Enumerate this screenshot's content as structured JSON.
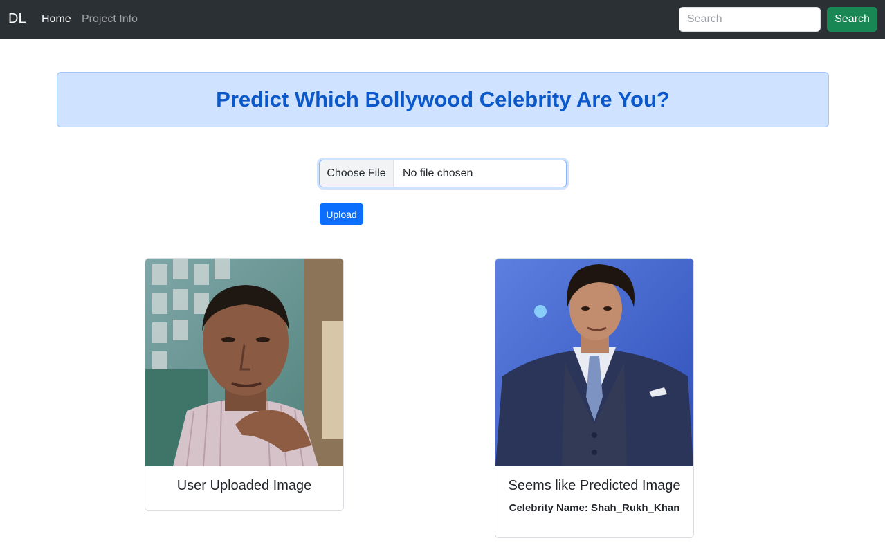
{
  "navbar": {
    "brand": "DL",
    "links": [
      {
        "label": "Home"
      },
      {
        "label": "Project Info"
      }
    ],
    "search": {
      "placeholder": "Search",
      "value": "",
      "button_label": "Search"
    }
  },
  "banner": {
    "title": "Predict Which Bollywood Celebrity Are You?"
  },
  "upload": {
    "choose_label": "Choose File",
    "file_status": "No file chosen",
    "button_label": "Upload"
  },
  "cards": {
    "user": {
      "title": "User Uploaded Image",
      "image": "user-photo"
    },
    "predicted": {
      "title": "Seems like Predicted Image",
      "caption": "Celebrity Name: Shah_Rukh_Khan",
      "image": "celebrity-photo"
    }
  },
  "colors": {
    "navbar_bg": "#2b3035",
    "banner_bg": "#cfe2ff",
    "banner_text": "#0a58ca",
    "search_button": "#198754",
    "upload_button": "#0d6efd"
  }
}
